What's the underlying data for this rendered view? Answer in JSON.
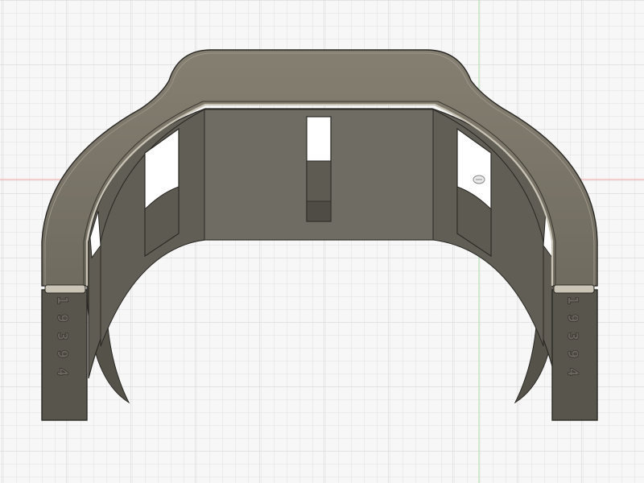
{
  "viewport": {
    "background": "#f7f7f7",
    "grid_minor_color": "#e1e1e1",
    "grid_major_color": "#cfcfcf",
    "x_axis_color": "#f2a4a4",
    "y_axis_color": "#a8dea8"
  },
  "model": {
    "body_color": "#7a7568",
    "outer_face_color": "#5c594f",
    "inner_wall_color": "#66635a",
    "slot_color": "#ffffff",
    "edge_color": "#2a2824",
    "highlight_color": "#c9c4b6"
  },
  "embossed_text": {
    "left_leg": "19394",
    "right_leg": "19394"
  }
}
